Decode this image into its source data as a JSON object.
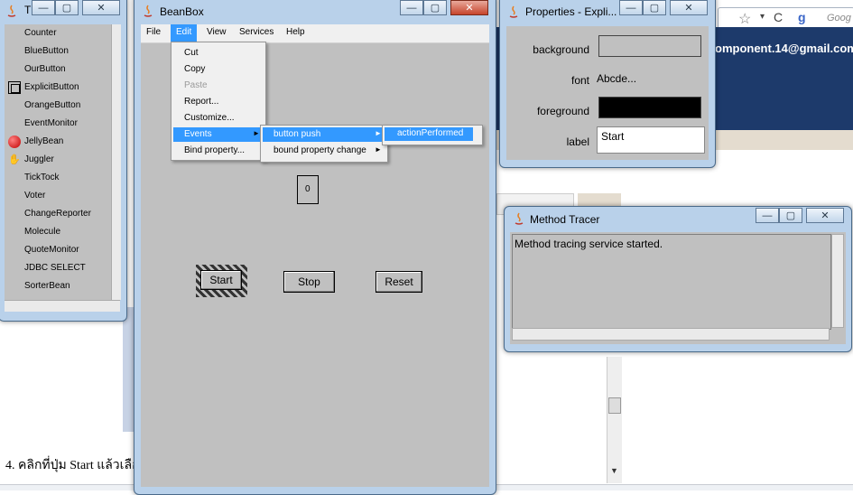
{
  "background_page": {
    "banner_text": "omponent.14@gmail.com",
    "caption": "4. คลิกที่ปุ่ม Start แล้วเลือ",
    "search_placeholder": "Goog",
    "dropdown_glyph": "▾",
    "refresh_glyph": "C",
    "google_glyph": "g"
  },
  "toolbox": {
    "title": "T",
    "items": [
      {
        "label": "Counter",
        "icon": "none"
      },
      {
        "label": "BlueButton",
        "icon": "none"
      },
      {
        "label": "OurButton",
        "icon": "none"
      },
      {
        "label": "ExplicitButton",
        "icon": "button-icon"
      },
      {
        "label": "OrangeButton",
        "icon": "none"
      },
      {
        "label": "EventMonitor",
        "icon": "none"
      },
      {
        "label": "JellyBean",
        "icon": "jellybean-icon"
      },
      {
        "label": "Juggler",
        "icon": "juggler-icon"
      },
      {
        "label": "TickTock",
        "icon": "none"
      },
      {
        "label": "Voter",
        "icon": "none"
      },
      {
        "label": "ChangeReporter",
        "icon": "none"
      },
      {
        "label": "Molecule",
        "icon": "none"
      },
      {
        "label": "QuoteMonitor",
        "icon": "none"
      },
      {
        "label": "JDBC SELECT",
        "icon": "none"
      },
      {
        "label": "SorterBean",
        "icon": "none"
      }
    ]
  },
  "beanbox": {
    "title": "BeanBox",
    "menus": [
      "File",
      "Edit",
      "View",
      "Services",
      "Help"
    ],
    "edit_menu": [
      "Cut",
      "Copy",
      "Paste",
      "Report...",
      "Customize...",
      "Events",
      "Bind property..."
    ],
    "events_submenu": [
      "button push",
      "bound property change"
    ],
    "button_push_submenu": [
      "actionPerformed"
    ],
    "counter_value": "0",
    "buttons": {
      "start": "Start",
      "stop": "Stop",
      "reset": "Reset"
    }
  },
  "properties": {
    "title": "Properties - Expli...",
    "rows": {
      "background": {
        "label": "background",
        "color": "#c0c0c0"
      },
      "font": {
        "label": "font",
        "value": "Abcde..."
      },
      "foreground": {
        "label": "foreground",
        "color": "#000000"
      },
      "label": {
        "label": "label",
        "value": "Start"
      }
    }
  },
  "tracer": {
    "title": "Method Tracer",
    "message": "Method tracing service started."
  },
  "window_controls": {
    "minimize": "—",
    "maximize": "▢",
    "close": "✕"
  }
}
